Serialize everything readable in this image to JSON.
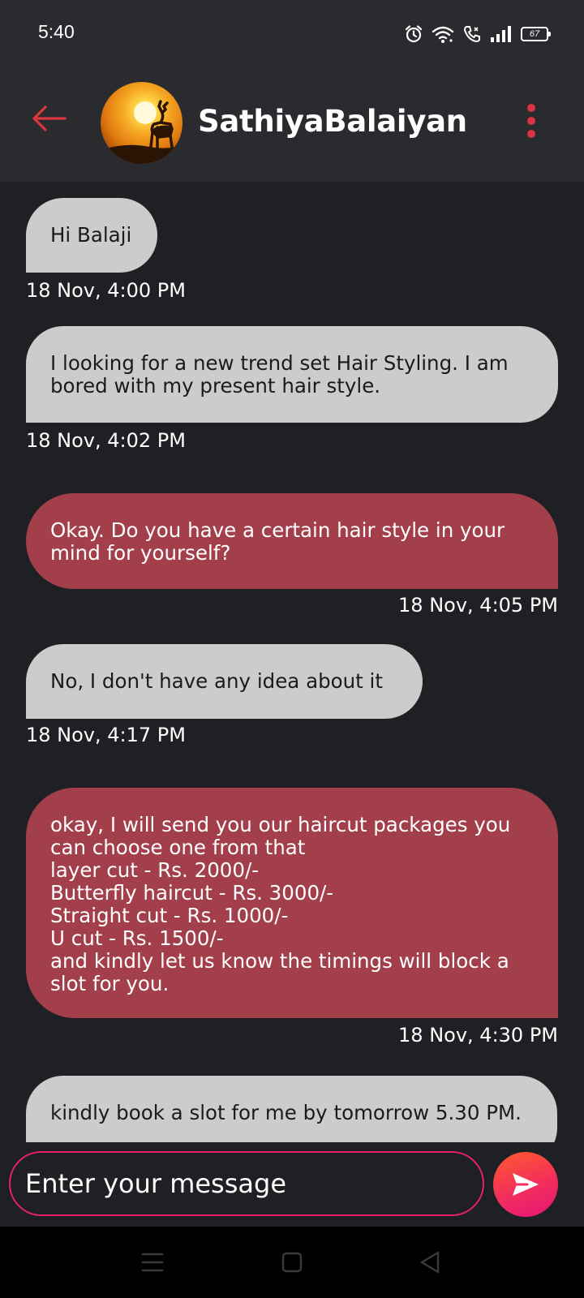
{
  "status_bar": {
    "time": "5:40",
    "battery": "67",
    "icons": [
      "alarm-icon",
      "wifi-icon",
      "volte-call-icon",
      "signal-icon",
      "battery-icon"
    ]
  },
  "header": {
    "contact_name": "SathiyaBalaiyan",
    "accent_color": "#d9363e",
    "icons": [
      "back-arrow-icon",
      "avatar",
      "more-vertical-icon"
    ]
  },
  "messages": [
    {
      "direction": "received",
      "text": "Hi Balaji",
      "time": "18 Nov, 4:00 PM"
    },
    {
      "direction": "received",
      "text": "I looking for a new trend set Hair Styling. I am\nbored with my present hair style.",
      "time": "18 Nov, 4:02 PM"
    },
    {
      "direction": "sent",
      "text": "Okay. Do you have a certain hair style in your\nmind for yourself?",
      "time": "18 Nov, 4:05 PM"
    },
    {
      "direction": "received",
      "text": "No, I don't have any idea about it",
      "time": "18 Nov, 4:17 PM"
    },
    {
      "direction": "sent",
      "text": "okay, I will send you our haircut packages you\ncan choose one from that\nlayer cut - Rs. 2000/-\nButterfly haircut - Rs. 3000/-\nStraight cut - Rs. 1000/-\nU cut - Rs. 1500/-\nand kindly let us know the timings will block a\nslot for you.",
      "time": "18 Nov, 4:30 PM"
    },
    {
      "direction": "received",
      "text": "kindly book a slot for me by tomorrow 5.30 PM.",
      "time": ""
    }
  ],
  "colors": {
    "received_bubble": "#cccccc",
    "sent_bubble": "#a33f4b",
    "background": "#1f2023",
    "header_background": "#292b2e",
    "input_border": "#e8216b"
  },
  "composer": {
    "placeholder": "Enter your message",
    "value": "",
    "send_icon": "send-icon"
  },
  "nav_bar": {
    "icons": [
      "recents-menu-icon",
      "home-square-icon",
      "back-triangle-icon"
    ]
  }
}
